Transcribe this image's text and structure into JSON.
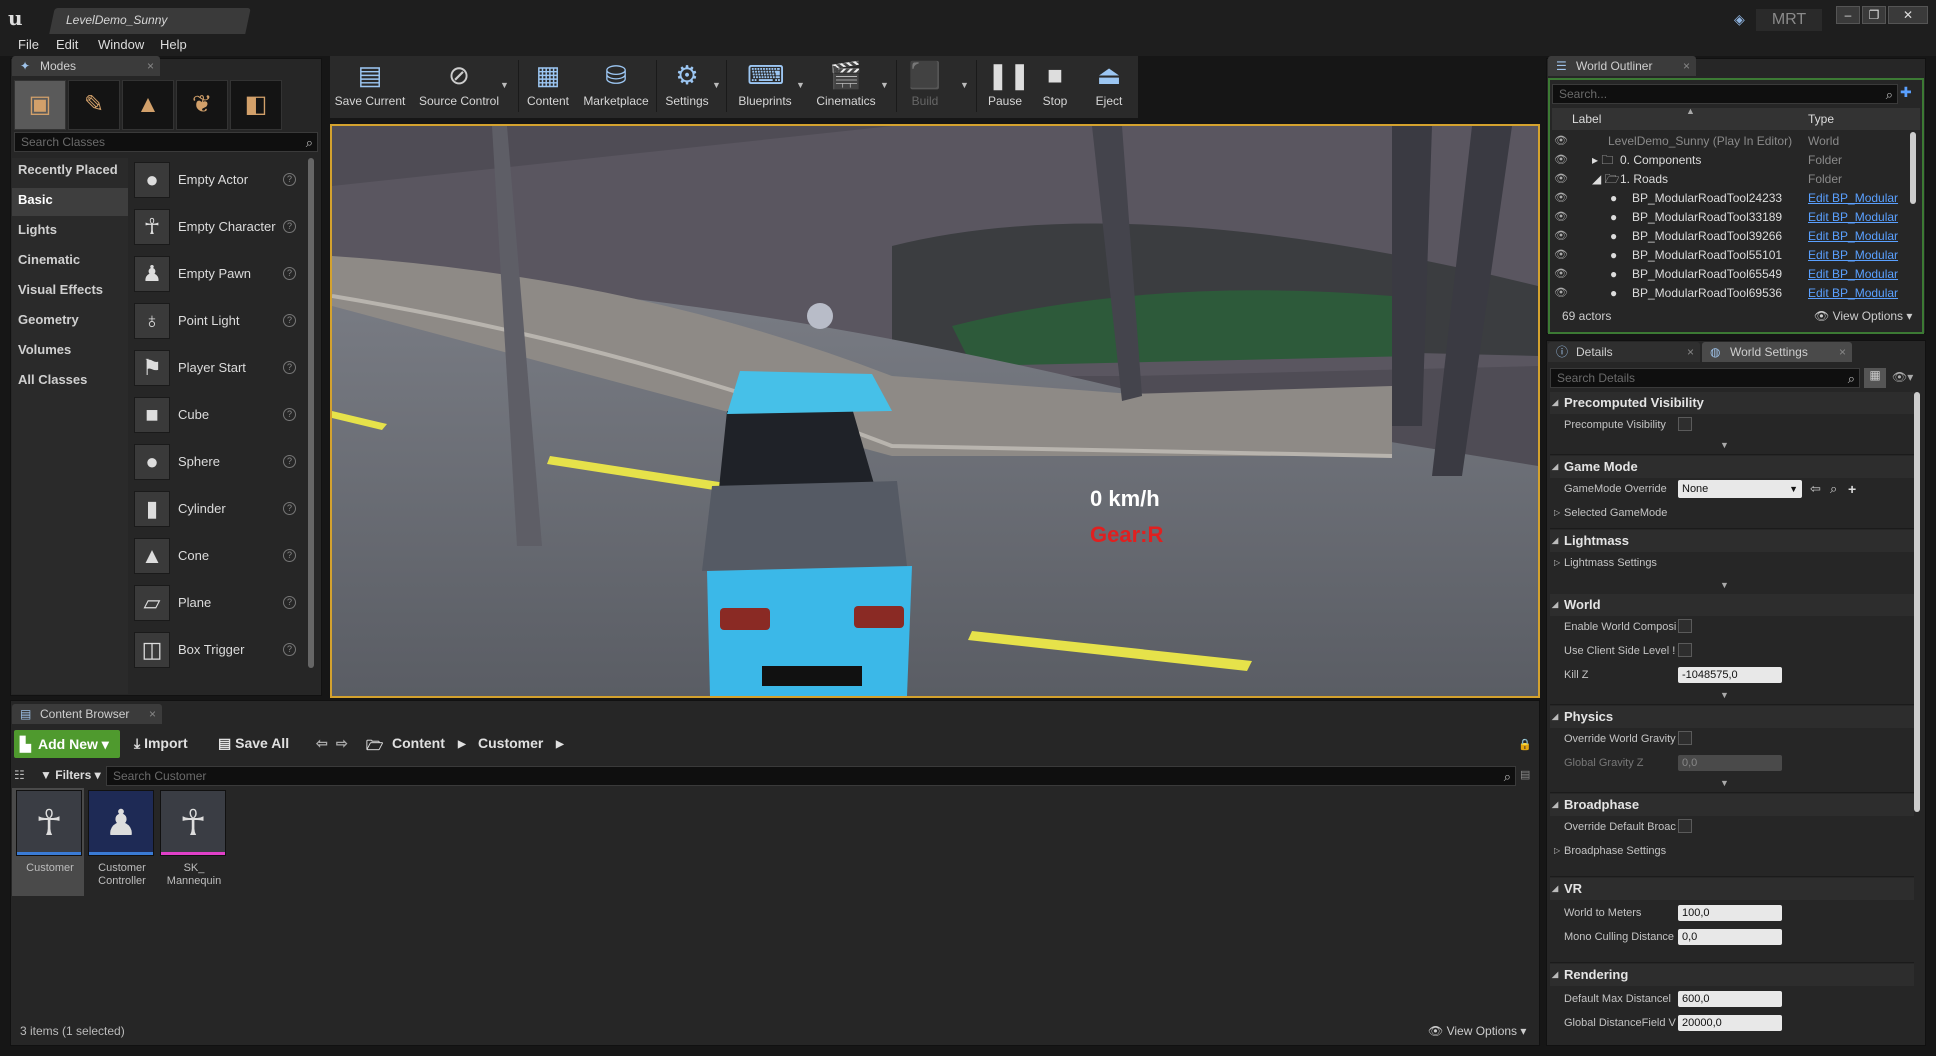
{
  "window": {
    "tab_title": "LevelDemo_Sunny",
    "project_badge": "MRT"
  },
  "menu": [
    "File",
    "Edit",
    "Window",
    "Help"
  ],
  "modes": {
    "tab_label": "Modes",
    "search_placeholder": "Search Classes",
    "mode_icons": [
      "place-mode-icon",
      "paint-mode-icon",
      "landscape-mode-icon",
      "foliage-mode-icon",
      "geometry-mode-icon"
    ],
    "categories": [
      "Recently Placed",
      "Basic",
      "Lights",
      "Cinematic",
      "Visual Effects",
      "Geometry",
      "Volumes",
      "All Classes"
    ],
    "selected_category": "Basic",
    "items": [
      "Empty Actor",
      "Empty Character",
      "Empty Pawn",
      "Point Light",
      "Player Start",
      "Cube",
      "Sphere",
      "Cylinder",
      "Cone",
      "Plane",
      "Box Trigger"
    ]
  },
  "toolbar": {
    "buttons": [
      "Save Current",
      "Source Control",
      "Content",
      "Marketplace",
      "Settings",
      "Blueprints",
      "Cinematics",
      "Build",
      "Pause",
      "Stop",
      "Eject"
    ]
  },
  "viewport": {
    "speed": "0 km/h",
    "gear": "Gear:R"
  },
  "content_browser": {
    "tab_label": "Content Browser",
    "add_new": "Add New",
    "import": "Import",
    "save_all": "Save All",
    "path": [
      "Content",
      "Customer"
    ],
    "filters": "Filters",
    "search_placeholder": "Search Customer",
    "assets": [
      {
        "name": "Customer",
        "bar_color": "#3a7bd5"
      },
      {
        "name": "Customer Controller",
        "bar_color": "#3a7bd5"
      },
      {
        "name": "SK_ Mannequin",
        "bar_color": "#e040c8"
      }
    ],
    "status": "3 items (1 selected)",
    "view_options": "View Options"
  },
  "outliner": {
    "tab_label": "World Outliner",
    "search_placeholder": "Search...",
    "col_label": "Label",
    "col_type": "Type",
    "rows": [
      {
        "label": "LevelDemo_Sunny (Play In Editor)",
        "type": "World"
      },
      {
        "label": "0. Components",
        "type": "Folder"
      },
      {
        "label": "1. Roads",
        "type": "Folder"
      },
      {
        "label": "BP_ModularRoadTool24233",
        "type": "Edit BP_Modular"
      },
      {
        "label": "BP_ModularRoadTool33189",
        "type": "Edit BP_Modular"
      },
      {
        "label": "BP_ModularRoadTool39266",
        "type": "Edit BP_Modular"
      },
      {
        "label": "BP_ModularRoadTool55101",
        "type": "Edit BP_Modular"
      },
      {
        "label": "BP_ModularRoadTool65549",
        "type": "Edit BP_Modular"
      },
      {
        "label": "BP_ModularRoadTool69536",
        "type": "Edit BP_Modular"
      }
    ],
    "actor_count": "69 actors",
    "view_options": "View Options"
  },
  "details": {
    "tab_details": "Details",
    "tab_world_settings": "World Settings",
    "search_placeholder": "Search Details",
    "sections": {
      "precomputed_visibility": "Precomputed Visibility",
      "precompute_visibility": "Precompute Visibility",
      "game_mode": "Game Mode",
      "gamemode_override": "GameMode Override",
      "gamemode_value": "None",
      "selected_gamemode": "Selected GameMode",
      "lightmass": "Lightmass",
      "lightmass_settings": "Lightmass Settings",
      "world": "World",
      "enable_world_composition": "Enable World Composi",
      "use_client_side_level": "Use Client Side Level !",
      "kill_z": "Kill Z",
      "kill_z_value": "-1048575,0",
      "physics": "Physics",
      "override_world_gravity": "Override World Gravity",
      "global_gravity_z": "Global Gravity Z",
      "global_gravity_value": "0,0",
      "broadphase": "Broadphase",
      "override_default_broad": "Override Default Broac",
      "broadphase_settings": "Broadphase Settings",
      "vr": "VR",
      "world_to_meters": "World to Meters",
      "world_to_meters_value": "100,0",
      "mono_culling": "Mono Culling Distance",
      "mono_culling_value": "0,0",
      "rendering": "Rendering",
      "default_max_distance": "Default Max Distancel",
      "default_max_distance_value": "600,0",
      "global_distancefield": "Global DistanceField V",
      "global_distancefield_value": "20000,0"
    }
  }
}
